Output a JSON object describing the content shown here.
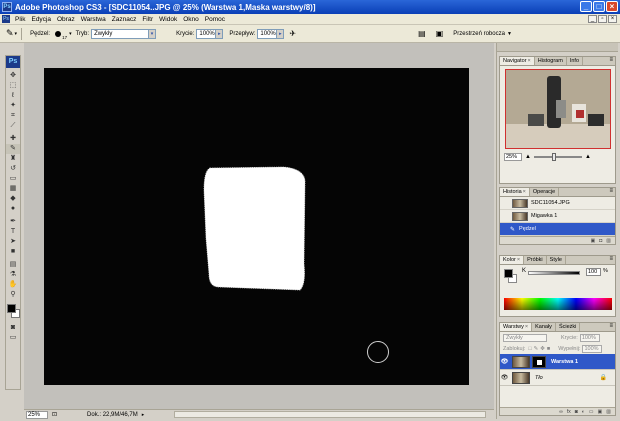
{
  "window": {
    "title": "Adobe Photoshop CS3 - [SDC11054..JPG @ 25% (Warstwa 1,Maska warstwy/8)]",
    "app_badge": "Ps"
  },
  "menu": [
    "Plik",
    "Edycja",
    "Obraz",
    "Warstwa",
    "Zaznacz",
    "Filtr",
    "Widok",
    "Okno",
    "Pomoc"
  ],
  "options": {
    "brush_label": "Pędzel:",
    "brush_size": "17",
    "mode_label": "Tryb:",
    "mode_value": "Zwykły",
    "opacity_label": "Krycie:",
    "opacity_value": "100%",
    "flow_label": "Przepływ:",
    "flow_value": "100%",
    "workspace": "Przestrzeń robocza"
  },
  "colors": {
    "foreground": "#000000",
    "background": "#ffffff",
    "canvas": "#050505",
    "selection_blue": "#2f58c8"
  },
  "status": {
    "zoom": "25%",
    "doc": "Dok.: 22,9M/46,7M"
  },
  "navigator": {
    "tabs": [
      "Navigator",
      "Histogram",
      "Info"
    ],
    "zoom": "25%"
  },
  "history": {
    "tabs": [
      "Historia",
      "Operacje"
    ],
    "items": [
      {
        "label": "SDC11054.JPG",
        "active": false
      },
      {
        "label": "Migawka 1",
        "active": false
      },
      {
        "label": "Pędzel",
        "active": true
      }
    ]
  },
  "color_panel": {
    "tabs": [
      "Kolor",
      "Próbki",
      "Style"
    ],
    "channel_label": "K",
    "channel_value": "100",
    "unit": "%"
  },
  "layers": {
    "tabs": [
      "Warstwy",
      "Kanały",
      "Ścieżki"
    ],
    "blend_mode": "Zwykły",
    "opacity_label": "Krycie:",
    "opacity_value": "100%",
    "lock_label": "Zablokuj:",
    "fill_label": "Wypełnij:",
    "fill_value": "100%",
    "items": [
      {
        "name": "Warstwa 1",
        "active": true
      },
      {
        "name": "Tło",
        "active": false
      }
    ]
  }
}
